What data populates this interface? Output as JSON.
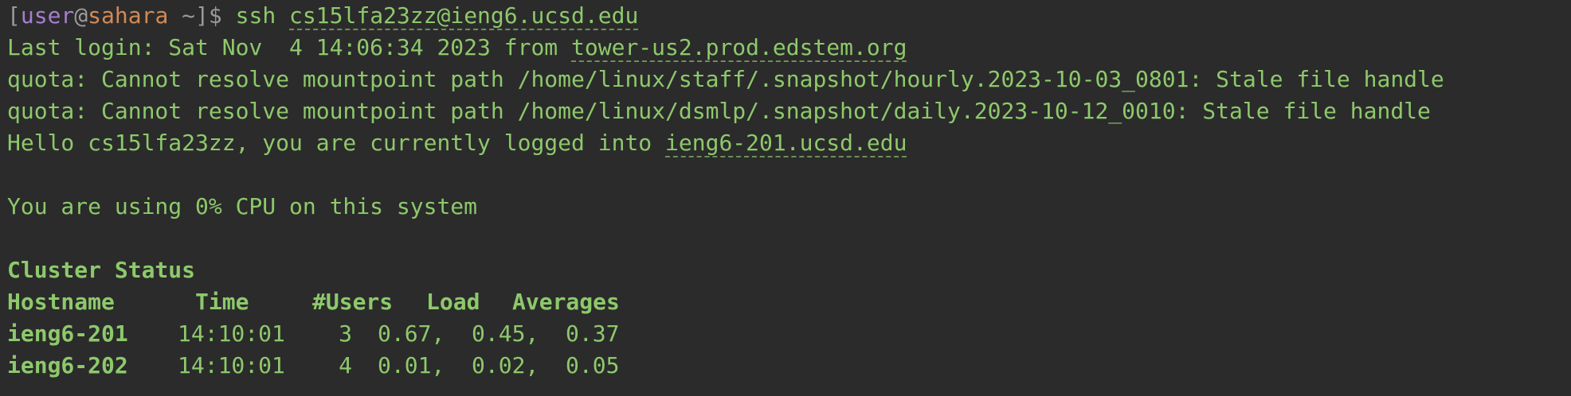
{
  "prompt": {
    "open_bracket": "[",
    "user": "user",
    "at": "@",
    "host": "sahara",
    "path": " ~",
    "close_bracket": "]$ ",
    "command": "ssh ",
    "target": "cs15lfa23zz@ieng6.ucsd.edu"
  },
  "login": {
    "prefix": "Last login: Sat Nov  4 14:06:34 2023 from ",
    "from_host": "tower-us2.prod.edstem.org"
  },
  "quota_lines": [
    "quota: Cannot resolve mountpoint path /home/linux/staff/.snapshot/hourly.2023-10-03_0801: Stale file handle",
    "quota: Cannot resolve mountpoint path /home/linux/dsmlp/.snapshot/daily.2023-10-12_0010: Stale file handle"
  ],
  "hello": {
    "prefix": "Hello cs15lfa23zz, you are currently logged into ",
    "host": "ieng6-201.ucsd.edu"
  },
  "cpu_line": "You are using 0% CPU on this system",
  "cluster": {
    "title": "Cluster Status",
    "headers": [
      "Hostname",
      "Time",
      "#Users",
      "Load",
      "Averages"
    ],
    "rows": [
      {
        "hostname": "ieng6-201",
        "time": "14:10:01",
        "users": "3",
        "load": "0.67,  0.45,  0.37"
      },
      {
        "hostname": "ieng6-202",
        "time": "14:10:01",
        "users": "4",
        "load": "0.01,  0.02,  0.05"
      }
    ]
  },
  "colors": {
    "background": "#2b2b2b",
    "text_green": "#8dc96b",
    "user_purple": "#a57ed0",
    "host_orange": "#d08a56"
  }
}
